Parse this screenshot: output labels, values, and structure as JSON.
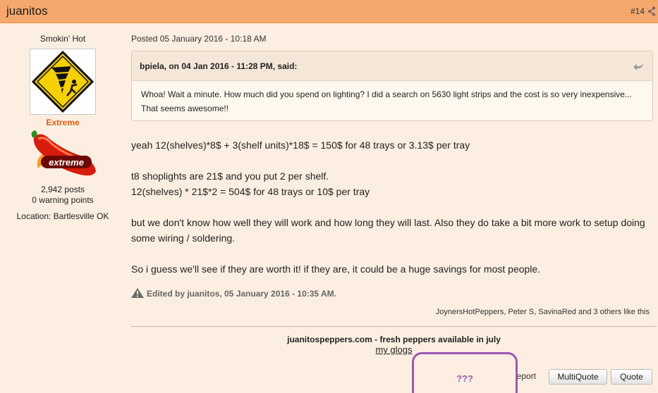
{
  "post": {
    "author": "juanitos",
    "number": "#14",
    "posted": "Posted 05 January 2016 - 10:18 AM"
  },
  "profile": {
    "rank": "Smokin' Hot",
    "group": "Extreme",
    "badge_text": "extreme",
    "posts": "2,942 posts",
    "warnings": "0 warning points",
    "location": "Location: Bartlesville OK"
  },
  "quote": {
    "header": "bpiela, on 04 Jan 2016 - 11:28 PM, said:",
    "text": "Whoa!  Wait a minute.  How much did you spend on lighting?  I did a search on 5630 light strips and the cost is so very inexpensive...  That seems awesome!!"
  },
  "body": {
    "p1": "yeah 12(shelves)*8$ + 3(shelf units)*18$ = 150$ for 48 trays or 3.13$ per tray",
    "p2a": "t8 shoplights are 21$ and you put 2 per shelf.",
    "p2b": "12(shelves) * 21$*2 = 504$ for 48 trays or 10$ per tray",
    "p3": "but we don't know how well they will work and how long they will last. Also they do take a bit more work to setup doing some wiring / soldering.",
    "p4": "So i guess we'll see if they are worth it! if they are, it could be a huge savings for most people."
  },
  "edited": "Edited by juanitos, 05 January 2016 - 10:35 AM.",
  "likes": "JoynersHotPeppers, Peter S, SavinaRed and 3 others like this",
  "signature": {
    "line1": "juanitospeppers.com - fresh peppers available in july",
    "line2": "my glogs"
  },
  "actions": {
    "report": "Report",
    "multiquote": "MultiQuote",
    "quote": "Quote"
  },
  "overlay": {
    "mark": "???"
  },
  "colors": {
    "header_bg": "#f5a86c",
    "page_bg": "#fcefe1",
    "group_color": "#e05a12",
    "highlight": "#9b58b5"
  }
}
